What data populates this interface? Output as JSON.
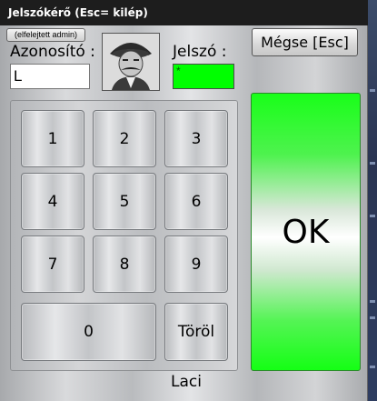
{
  "window": {
    "title": "Jelszókérő (Esc= kilép)"
  },
  "header": {
    "forgot_admin_label": "(elfelejtett admin)",
    "user_label": "Azonosító :",
    "user_value": "L",
    "password_label": "Jelszó :",
    "password_value": "*",
    "cancel_label": "Mégse [Esc]"
  },
  "keypad": {
    "k1": "1",
    "k2": "2",
    "k3": "3",
    "k4": "4",
    "k5": "5",
    "k6": "6",
    "k7": "7",
    "k8": "8",
    "k9": "9",
    "k0": "0",
    "delete_label": "Töröl"
  },
  "ok_label": "OK",
  "footer": {
    "user_name": "Laci"
  },
  "colors": {
    "password_field": "#00ff00",
    "ok_button": "#19ff19",
    "titlebar": "#1d1d1d"
  },
  "icons": {
    "avatar": "user-photo"
  }
}
